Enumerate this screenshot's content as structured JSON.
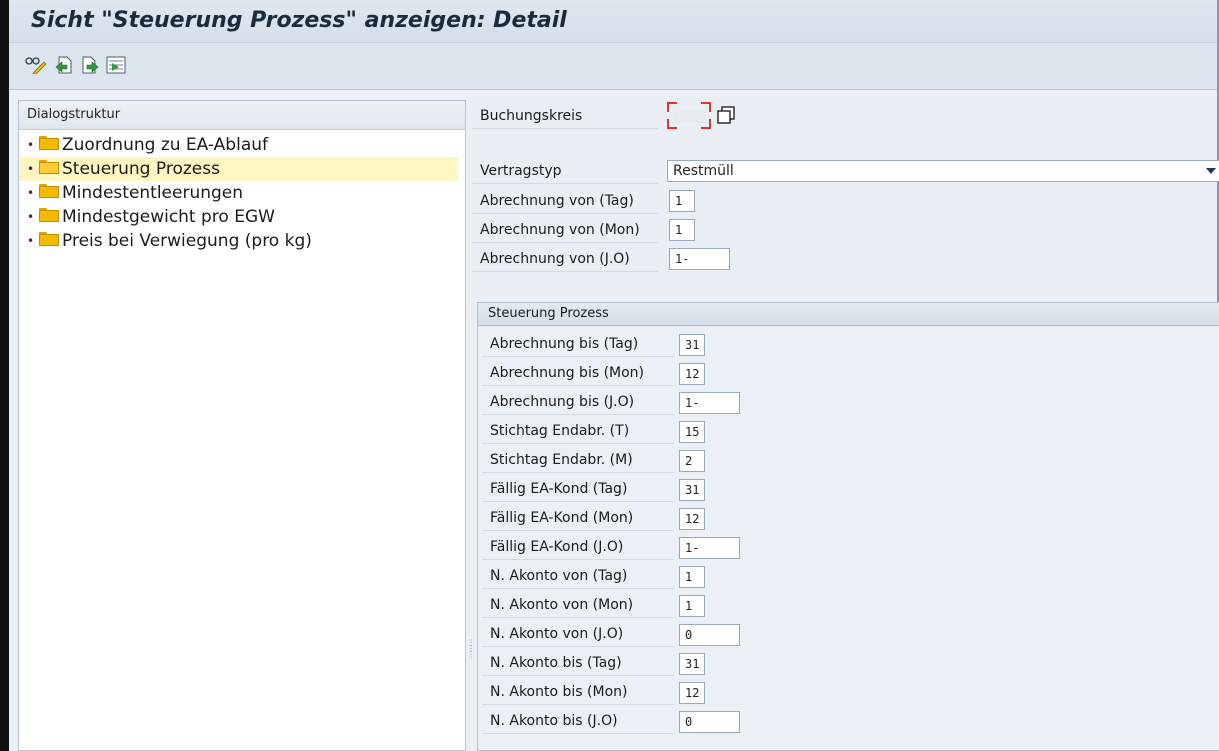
{
  "window": {
    "title": "Sicht \"Steuerung Prozess\" anzeigen: Detail"
  },
  "toolbar": {
    "buttons": [
      {
        "icon": "glasses-edit-icon"
      },
      {
        "icon": "previous-entry-icon"
      },
      {
        "icon": "next-entry-icon"
      },
      {
        "icon": "select-block-icon"
      }
    ]
  },
  "tree": {
    "header": "Dialogstruktur",
    "items": [
      {
        "label": "Zuordnung zu EA-Ablauf",
        "selected": false
      },
      {
        "label": "Steuerung Prozess",
        "selected": true
      },
      {
        "label": "Mindestentleerungen",
        "selected": false
      },
      {
        "label": "Mindestgewicht pro EGW",
        "selected": false
      },
      {
        "label": "Preis bei Verwiegung (pro kg)",
        "selected": false
      }
    ]
  },
  "form": {
    "buchungskreis": {
      "label": "Buchungskreis",
      "value": ""
    },
    "vertragstyp": {
      "label": "Vertragstyp",
      "value": "Restmüll"
    },
    "fields": [
      {
        "label": "Abrechnung von (Tag)",
        "value": "1"
      },
      {
        "label": "Abrechnung von (Mon)",
        "value": "1"
      },
      {
        "label": "Abrechnung von (J.O)",
        "value": "1-"
      }
    ]
  },
  "group": {
    "title": "Steuerung Prozess",
    "fields": [
      {
        "label": "Abrechnung bis (Tag)",
        "value": "31",
        "wide": false
      },
      {
        "label": "Abrechnung bis (Mon)",
        "value": "12",
        "wide": false
      },
      {
        "label": "Abrechnung bis (J.O)",
        "value": "1-",
        "wide": true
      },
      {
        "label": "Stichtag Endabr. (T)",
        "value": "15",
        "wide": false
      },
      {
        "label": "Stichtag Endabr. (M)",
        "value": "2",
        "wide": false
      },
      {
        "label": "Fällig EA-Kond (Tag)",
        "value": "31",
        "wide": false
      },
      {
        "label": "Fällig EA-Kond (Mon)",
        "value": "12",
        "wide": false
      },
      {
        "label": "Fällig EA-Kond (J.O)",
        "value": "1-",
        "wide": true
      },
      {
        "label": "N. Akonto von (Tag)",
        "value": "1",
        "wide": false
      },
      {
        "label": "N. Akonto von (Mon)",
        "value": "1",
        "wide": false
      },
      {
        "label": "N. Akonto von (J.O)",
        "value": "0",
        "wide": true
      },
      {
        "label": "N. Akonto bis (Tag)",
        "value": "31",
        "wide": false
      },
      {
        "label": "N. Akonto bis (Mon)",
        "value": "12",
        "wide": false
      },
      {
        "label": "N. Akonto bis (J.O)",
        "value": "0",
        "wide": true
      }
    ]
  }
}
